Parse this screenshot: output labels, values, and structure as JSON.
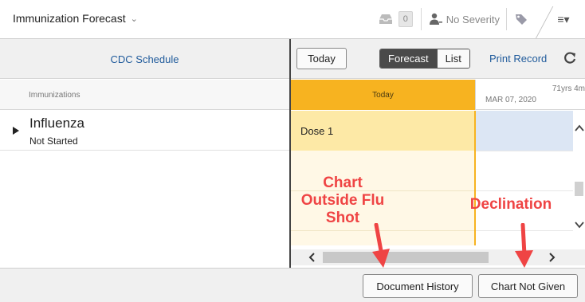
{
  "header": {
    "title": "Immunization Forecast",
    "count": "0",
    "severity_label": "No Severity"
  },
  "toolbar": {
    "schedule_link": "CDC Schedule",
    "today_button": "Today",
    "forecast_label": "Forecast",
    "list_label": "List",
    "print_link": "Print Record"
  },
  "columns": {
    "immunizations": "Immunizations",
    "today": "Today",
    "age": "71yrs 4m",
    "date": "MAR 07, 2020"
  },
  "immunization": {
    "name": "Influenza",
    "status": "Not Started",
    "dose": "Dose 1"
  },
  "annotations": {
    "chart_outside": [
      "Chart",
      "Outside Flu",
      "Shot"
    ],
    "declination": "Declination"
  },
  "footer": {
    "history_button": "Document History",
    "not_given_button": "Chart Not Given"
  },
  "colors": {
    "today_header": "#f7b320",
    "dose_cell": "#fde9a6",
    "future_cell": "#dce6f4",
    "link": "#1f5a9b",
    "annotation": "#ef4444"
  }
}
